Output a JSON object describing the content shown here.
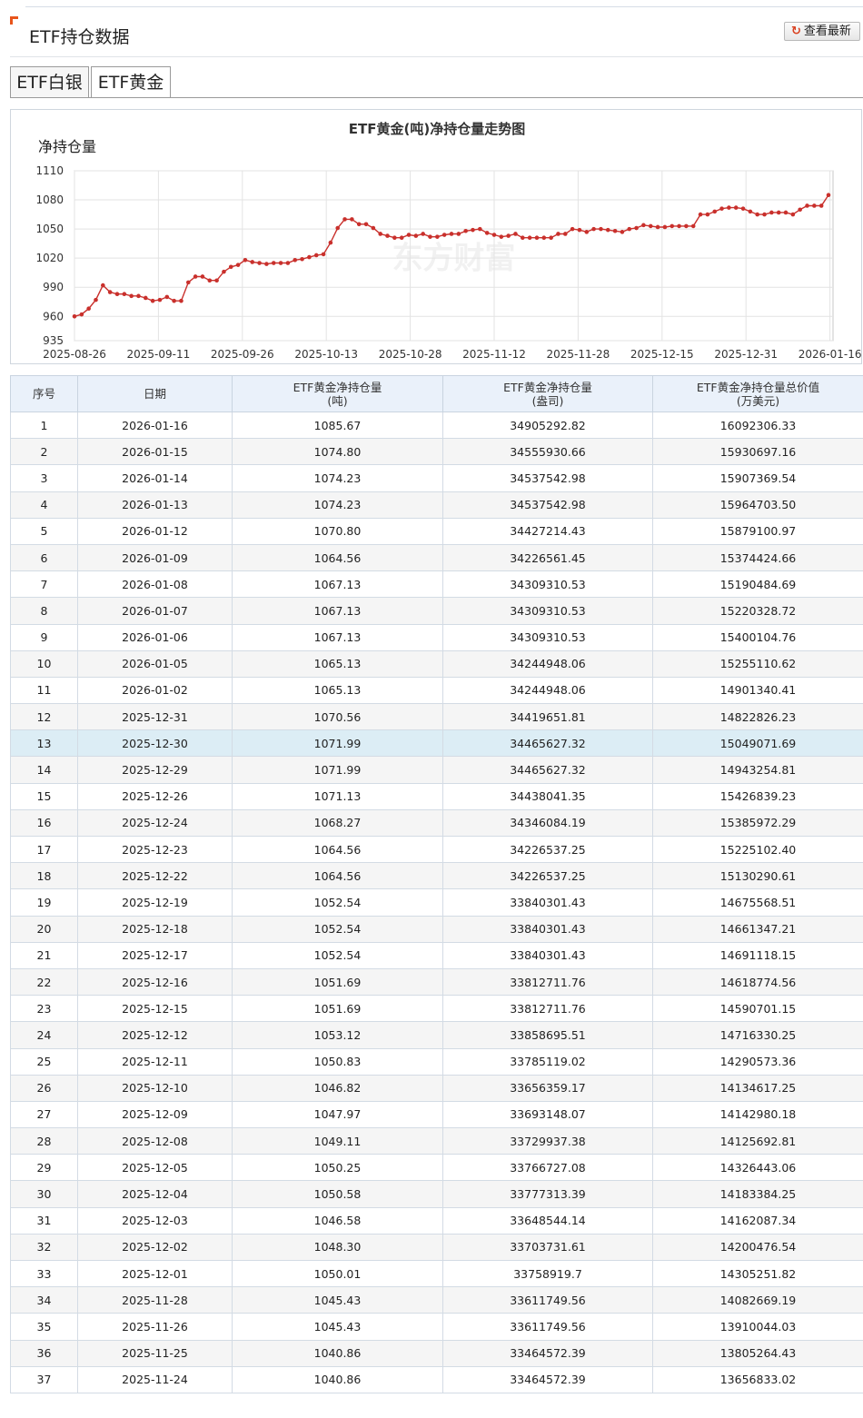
{
  "header": {
    "title": "ETF持仓数据",
    "refresh_label": "查看最新"
  },
  "tabs": [
    {
      "label": "ETF白银"
    },
    {
      "label": "ETF黄金"
    }
  ],
  "chart_data": {
    "type": "line",
    "title": "ETF黄金(吨)净持仓量走势图",
    "ylabel": "净持仓量",
    "xlabel": "",
    "ylim": [
      935,
      1110
    ],
    "yticks": [
      935,
      960,
      990,
      1020,
      1050,
      1080,
      1110
    ],
    "xticks": [
      "2025-08-26",
      "2025-09-11",
      "2025-09-26",
      "2025-10-13",
      "2025-10-28",
      "2025-11-12",
      "2025-11-28",
      "2025-12-15",
      "2025-12-31",
      "2026-01-16"
    ],
    "grid": true,
    "watermark": "东方财富",
    "series": [
      {
        "color": "#c9302c",
        "values": [
          960,
          962,
          968,
          977,
          992,
          985,
          983,
          983,
          981,
          981,
          979,
          976,
          977,
          980,
          976,
          976,
          995,
          1001,
          1001,
          997,
          997,
          1006,
          1011,
          1013,
          1018,
          1016,
          1015,
          1014,
          1015,
          1015,
          1015,
          1018,
          1019,
          1021,
          1023,
          1024,
          1036,
          1051,
          1060,
          1060,
          1055,
          1055,
          1051,
          1045,
          1043,
          1041,
          1041,
          1044,
          1043,
          1045,
          1042,
          1042,
          1044,
          1045,
          1045,
          1048,
          1049,
          1050,
          1046,
          1044,
          1042,
          1043,
          1045,
          1041,
          1041,
          1041,
          1041,
          1041,
          1045,
          1045,
          1050,
          1049,
          1047,
          1050,
          1050,
          1049,
          1048,
          1047,
          1050,
          1051,
          1054,
          1053,
          1052,
          1052,
          1053,
          1053,
          1053,
          1053,
          1065,
          1065,
          1068,
          1071,
          1072,
          1072,
          1071,
          1068,
          1065,
          1065,
          1067,
          1067,
          1067,
          1065,
          1070,
          1074,
          1074,
          1074,
          1085
        ]
      }
    ]
  },
  "table": {
    "headers": [
      {
        "l1": "序号",
        "l2": ""
      },
      {
        "l1": "日期",
        "l2": ""
      },
      {
        "l1": "ETF黄金净持仓量",
        "l2": "(吨)"
      },
      {
        "l1": "ETF黄金净持仓量",
        "l2": "(盎司)"
      },
      {
        "l1": "ETF黄金净持仓量总价值",
        "l2": "(万美元)"
      }
    ],
    "highlight_row": 13,
    "rows": [
      [
        "1",
        "2026-01-16",
        "1085.67",
        "34905292.82",
        "16092306.33"
      ],
      [
        "2",
        "2026-01-15",
        "1074.80",
        "34555930.66",
        "15930697.16"
      ],
      [
        "3",
        "2026-01-14",
        "1074.23",
        "34537542.98",
        "15907369.54"
      ],
      [
        "4",
        "2026-01-13",
        "1074.23",
        "34537542.98",
        "15964703.50"
      ],
      [
        "5",
        "2026-01-12",
        "1070.80",
        "34427214.43",
        "15879100.97"
      ],
      [
        "6",
        "2026-01-09",
        "1064.56",
        "34226561.45",
        "15374424.66"
      ],
      [
        "7",
        "2026-01-08",
        "1067.13",
        "34309310.53",
        "15190484.69"
      ],
      [
        "8",
        "2026-01-07",
        "1067.13",
        "34309310.53",
        "15220328.72"
      ],
      [
        "9",
        "2026-01-06",
        "1067.13",
        "34309310.53",
        "15400104.76"
      ],
      [
        "10",
        "2026-01-05",
        "1065.13",
        "34244948.06",
        "15255110.62"
      ],
      [
        "11",
        "2026-01-02",
        "1065.13",
        "34244948.06",
        "14901340.41"
      ],
      [
        "12",
        "2025-12-31",
        "1070.56",
        "34419651.81",
        "14822826.23"
      ],
      [
        "13",
        "2025-12-30",
        "1071.99",
        "34465627.32",
        "15049071.69"
      ],
      [
        "14",
        "2025-12-29",
        "1071.99",
        "34465627.32",
        "14943254.81"
      ],
      [
        "15",
        "2025-12-26",
        "1071.13",
        "34438041.35",
        "15426839.23"
      ],
      [
        "16",
        "2025-12-24",
        "1068.27",
        "34346084.19",
        "15385972.29"
      ],
      [
        "17",
        "2025-12-23",
        "1064.56",
        "34226537.25",
        "15225102.40"
      ],
      [
        "18",
        "2025-12-22",
        "1064.56",
        "34226537.25",
        "15130290.61"
      ],
      [
        "19",
        "2025-12-19",
        "1052.54",
        "33840301.43",
        "14675568.51"
      ],
      [
        "20",
        "2025-12-18",
        "1052.54",
        "33840301.43",
        "14661347.21"
      ],
      [
        "21",
        "2025-12-17",
        "1052.54",
        "33840301.43",
        "14691118.15"
      ],
      [
        "22",
        "2025-12-16",
        "1051.69",
        "33812711.76",
        "14618774.56"
      ],
      [
        "23",
        "2025-12-15",
        "1051.69",
        "33812711.76",
        "14590701.15"
      ],
      [
        "24",
        "2025-12-12",
        "1053.12",
        "33858695.51",
        "14716330.25"
      ],
      [
        "25",
        "2025-12-11",
        "1050.83",
        "33785119.02",
        "14290573.36"
      ],
      [
        "26",
        "2025-12-10",
        "1046.82",
        "33656359.17",
        "14134617.25"
      ],
      [
        "27",
        "2025-12-09",
        "1047.97",
        "33693148.07",
        "14142980.18"
      ],
      [
        "28",
        "2025-12-08",
        "1049.11",
        "33729937.38",
        "14125692.81"
      ],
      [
        "29",
        "2025-12-05",
        "1050.25",
        "33766727.08",
        "14326443.06"
      ],
      [
        "30",
        "2025-12-04",
        "1050.58",
        "33777313.39",
        "14183384.25"
      ],
      [
        "31",
        "2025-12-03",
        "1046.58",
        "33648544.14",
        "14162087.34"
      ],
      [
        "32",
        "2025-12-02",
        "1048.30",
        "33703731.61",
        "14200476.54"
      ],
      [
        "33",
        "2025-12-01",
        "1050.01",
        "33758919.7",
        "14305251.82"
      ],
      [
        "34",
        "2025-11-28",
        "1045.43",
        "33611749.56",
        "14082669.19"
      ],
      [
        "35",
        "2025-11-26",
        "1045.43",
        "33611749.56",
        "13910044.03"
      ],
      [
        "36",
        "2025-11-25",
        "1040.86",
        "33464572.39",
        "13805264.43"
      ],
      [
        "37",
        "2025-11-24",
        "1040.86",
        "33464572.39",
        "13656833.02"
      ]
    ]
  }
}
